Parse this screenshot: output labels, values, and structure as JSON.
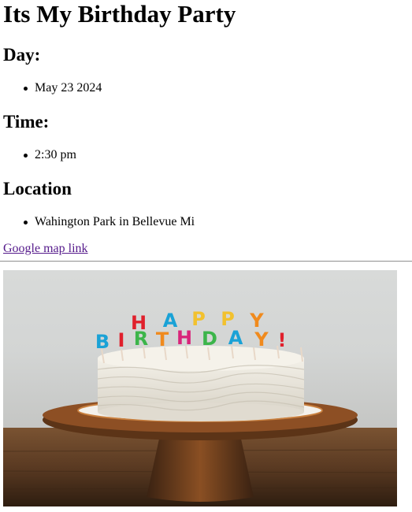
{
  "page": {
    "title": "Its My Birthday Party"
  },
  "sections": {
    "day": {
      "heading": "Day:",
      "items": [
        "May 23 2024"
      ]
    },
    "time": {
      "heading": "Time:",
      "items": [
        "2:30 pm"
      ]
    },
    "location": {
      "heading": "Location",
      "items": [
        "Wahington Park in Bellevue Mi"
      ]
    }
  },
  "map_link": {
    "label": "Google map link"
  },
  "image": {
    "subject": "birthday cake with candles",
    "candle_letters_top": "HAPPY",
    "candle_letters_bottom": "BIRTHDAY!"
  },
  "colors": {
    "link": "#551a8b",
    "text": "#000000",
    "background": "#ffffff"
  }
}
